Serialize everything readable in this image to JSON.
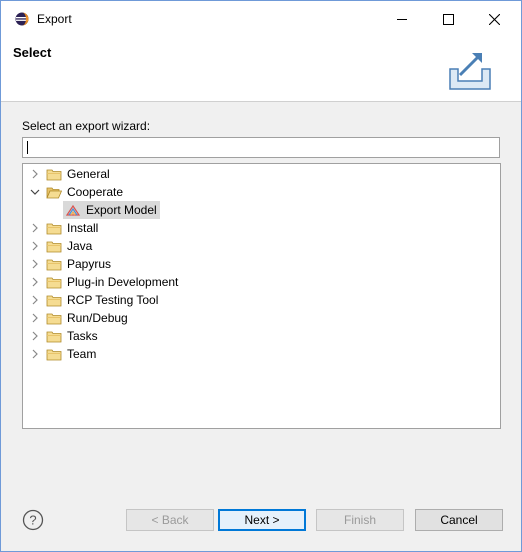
{
  "window": {
    "title": "Export",
    "icon": "eclipse-icon"
  },
  "header": {
    "title": "Select",
    "icon": "export-wizard-icon"
  },
  "prompt": "Select an export wizard:",
  "filter": {
    "value": "",
    "placeholder": ""
  },
  "tree": [
    {
      "label": "General",
      "expanded": false
    },
    {
      "label": "Cooperate",
      "expanded": true
    },
    {
      "label": "Export Model",
      "selected": true
    },
    {
      "label": "Install",
      "expanded": false
    },
    {
      "label": "Java",
      "expanded": false
    },
    {
      "label": "Papyrus",
      "expanded": false
    },
    {
      "label": "Plug-in Development",
      "expanded": false
    },
    {
      "label": "RCP Testing Tool",
      "expanded": false
    },
    {
      "label": "Run/Debug",
      "expanded": false
    },
    {
      "label": "Tasks",
      "expanded": false
    },
    {
      "label": "Team",
      "expanded": false
    }
  ],
  "buttons": {
    "back": "< Back",
    "next": "Next >",
    "finish": "Finish",
    "cancel": "Cancel"
  },
  "colors": {
    "accent": "#0078d7",
    "folder": "#e8c46a"
  }
}
